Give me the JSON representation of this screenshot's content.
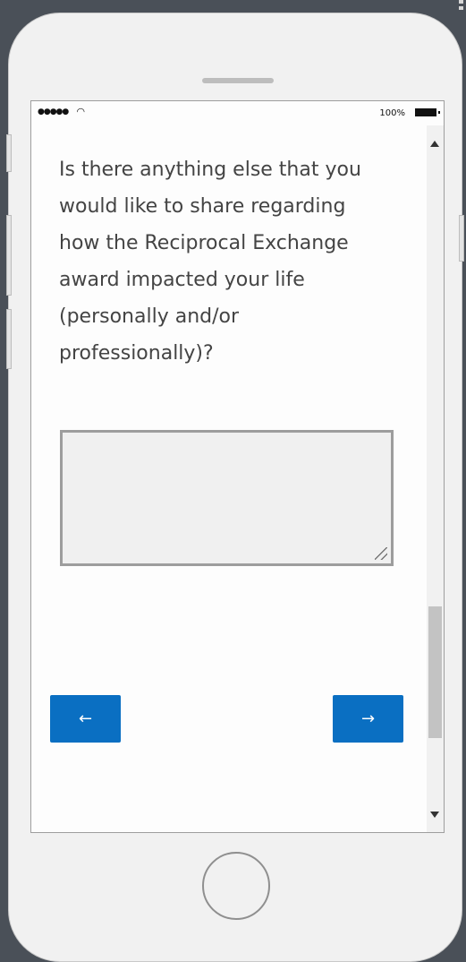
{
  "status_bar": {
    "signal_icon": "signal-dots-icon",
    "wifi_icon": "wifi-icon",
    "battery_percent": "100%",
    "battery_icon": "battery-icon"
  },
  "survey": {
    "question": "Is there anything else that you would like to share regarding how the Reciprocal Exchange award impacted your life (personally and/or professionally)?",
    "answer_value": "",
    "answer_placeholder": ""
  },
  "navigation": {
    "prev_label": "←",
    "next_label": "→"
  },
  "colors": {
    "accent": "#0a6fc2",
    "device_body": "#f1f1f1",
    "backdrop": "#4a5058"
  }
}
